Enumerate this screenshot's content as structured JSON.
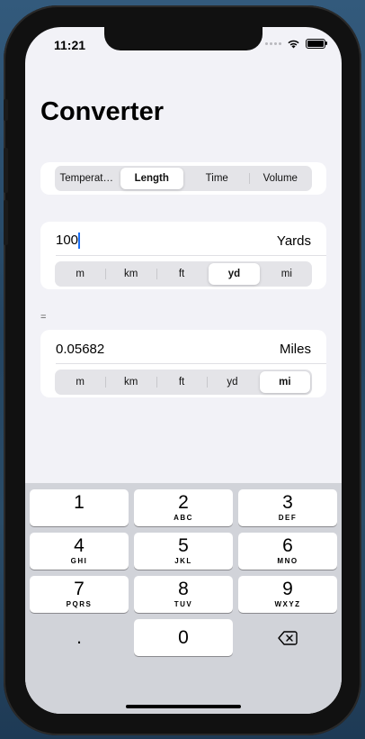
{
  "status_bar": {
    "time": "11:21"
  },
  "title": "Converter",
  "category_tabs": [
    {
      "label": "Temperat…",
      "selected": false
    },
    {
      "label": "Length",
      "selected": true
    },
    {
      "label": "Time",
      "selected": false
    },
    {
      "label": "Volume",
      "selected": false
    }
  ],
  "input": {
    "value": "100",
    "unit_label": "Yards",
    "units": [
      "m",
      "km",
      "ft",
      "yd",
      "mi"
    ],
    "selected_unit": "yd"
  },
  "equals_sign": "=",
  "output": {
    "value": "0.05682",
    "unit_label": "Miles",
    "units": [
      "m",
      "km",
      "ft",
      "yd",
      "mi"
    ],
    "selected_unit": "mi"
  },
  "keyboard": {
    "keys": [
      {
        "num": "1",
        "letters": ""
      },
      {
        "num": "2",
        "letters": "ABC"
      },
      {
        "num": "3",
        "letters": "DEF"
      },
      {
        "num": "4",
        "letters": "GHI"
      },
      {
        "num": "5",
        "letters": "JKL"
      },
      {
        "num": "6",
        "letters": "MNO"
      },
      {
        "num": "7",
        "letters": "PQRS"
      },
      {
        "num": "8",
        "letters": "TUV"
      },
      {
        "num": "9",
        "letters": "WXYZ"
      },
      {
        "num": ".",
        "letters": ""
      },
      {
        "num": "0",
        "letters": ""
      }
    ],
    "backspace_icon": "delete-backward-icon"
  },
  "colors": {
    "accent_caret": "#1a6ef5",
    "screen_background": "#f2f2f7",
    "keyboard_background": "#d1d3d9"
  }
}
